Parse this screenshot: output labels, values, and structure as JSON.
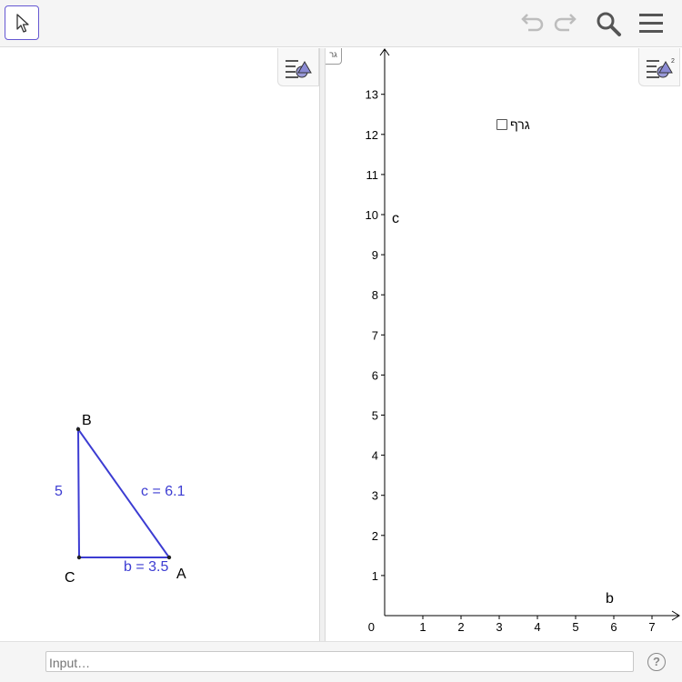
{
  "toolbar": {
    "move_tool": "arrow-cursor-icon",
    "undo": "undo-icon",
    "redo": "redo-icon",
    "search": "search-icon",
    "menu": "hamburger-menu-icon"
  },
  "graphics1": {
    "points": {
      "A": "A",
      "B": "B",
      "C": "C"
    },
    "side_a_label": "5",
    "side_b_label": "b = 3.5",
    "side_c_label": "c = 6.1",
    "triangle_color": "#3c3cd2"
  },
  "graphics2": {
    "tab_label": "גר",
    "checkbox_label": "גרף",
    "x_axis_name": "b",
    "y_axis_name": "c",
    "origin_label": "0",
    "x_ticks": [
      "1",
      "2",
      "3",
      "4",
      "5",
      "6",
      "7"
    ],
    "y_ticks": [
      "1",
      "2",
      "3",
      "4",
      "5",
      "6",
      "7",
      "8",
      "9",
      "10",
      "11",
      "12",
      "13"
    ]
  },
  "input_bar": {
    "placeholder": "Input…",
    "help_label": "?"
  }
}
